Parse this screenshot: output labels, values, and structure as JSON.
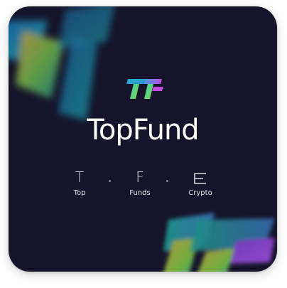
{
  "brand": {
    "name": "TopFund"
  },
  "pillars": [
    {
      "glyph": "T",
      "caption": "Top"
    },
    {
      "glyph": "F",
      "caption": "Funds"
    },
    {
      "glyph": "",
      "icon": "crypto-c-icon",
      "caption": "Crypto"
    }
  ],
  "colors": {
    "background": "#16142a",
    "text": "#ffffff",
    "gradient_start": "#22c7c9",
    "gradient_mid": "#7ed957",
    "gradient_end": "#c945e8"
  }
}
